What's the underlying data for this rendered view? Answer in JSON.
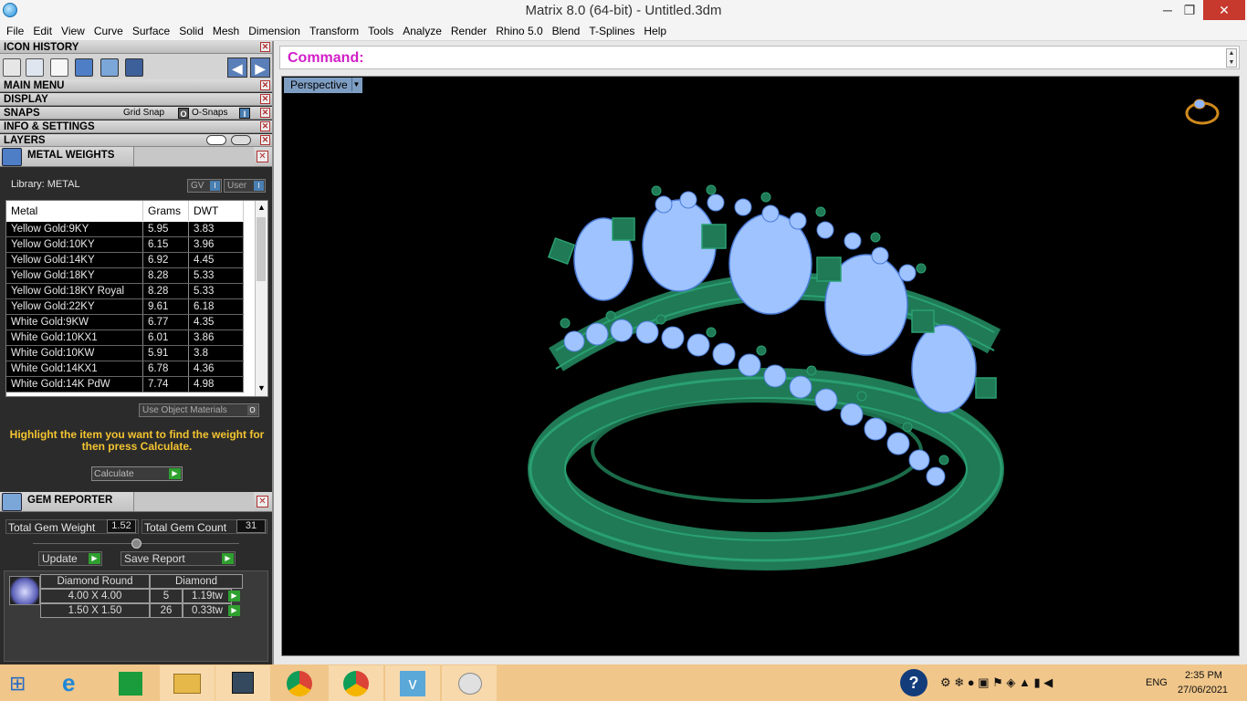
{
  "window": {
    "title": "Matrix 8.0 (64-bit) - Untitled.3dm",
    "min": "─",
    "max": "❐",
    "close": "✕"
  },
  "menu": [
    "File",
    "Edit",
    "View",
    "Curve",
    "Surface",
    "Solid",
    "Mesh",
    "Dimension",
    "Transform",
    "Tools",
    "Analyze",
    "Render",
    "Rhino 5.0",
    "Blend",
    "T-Splines",
    "Help"
  ],
  "sections": {
    "icon_history": "ICON HISTORY",
    "main_menu": "MAIN MENU",
    "display": "DISPLAY",
    "snaps": "SNAPS",
    "grid_snap": "Grid Snap",
    "o_snaps": "O-Snaps",
    "info_settings": "INFO & SETTINGS",
    "layers": "LAYERS"
  },
  "metal_weights": {
    "title": "METAL WEIGHTS",
    "library": "Library: METAL",
    "gv": "GV",
    "user": "User",
    "columns": [
      "Metal",
      "Grams",
      "DWT"
    ],
    "rows": [
      [
        "Yellow Gold:9KY",
        "5.95",
        "3.83"
      ],
      [
        "Yellow Gold:10KY",
        "6.15",
        "3.96"
      ],
      [
        "Yellow Gold:14KY",
        "6.92",
        "4.45"
      ],
      [
        "Yellow Gold:18KY",
        "8.28",
        "5.33"
      ],
      [
        "Yellow Gold:18KY Royal",
        "8.28",
        "5.33"
      ],
      [
        "Yellow Gold:22KY",
        "9.61",
        "6.18"
      ],
      [
        "White Gold:9KW",
        "6.77",
        "4.35"
      ],
      [
        "White Gold:10KX1",
        "6.01",
        "3.86"
      ],
      [
        "White Gold:10KW",
        "5.91",
        "3.8"
      ],
      [
        "White Gold:14KX1",
        "6.78",
        "4.36"
      ],
      [
        "White Gold:14K PdW",
        "7.74",
        "4.98"
      ]
    ],
    "use_object_materials": "Use Object Materials",
    "hint": "Highlight the item you want to find the weight for then press Calculate.",
    "calculate": "Calculate"
  },
  "gem_reporter": {
    "title": "GEM REPORTER",
    "total_weight_label": "Total Gem Weight",
    "total_weight": "1.52",
    "total_count_label": "Total Gem Count",
    "total_count": "31",
    "update": "Update",
    "save_report": "Save Report",
    "header": [
      "Diamond Round",
      "Diamond"
    ],
    "rows": [
      [
        "4.00 X 4.00",
        "5",
        "1.19tw"
      ],
      [
        "1.50 X 1.50",
        "26",
        "0.33tw"
      ]
    ]
  },
  "command": {
    "label": "Command:"
  },
  "viewport": {
    "name": "Perspective"
  },
  "tray": {
    "lang": "ENG",
    "time": "2:35 PM",
    "date": "27/06/2021"
  },
  "colors": {
    "metal": "#1f7a55",
    "gem": "#9ec3ff",
    "accent_cmd": "#d21ec8"
  }
}
